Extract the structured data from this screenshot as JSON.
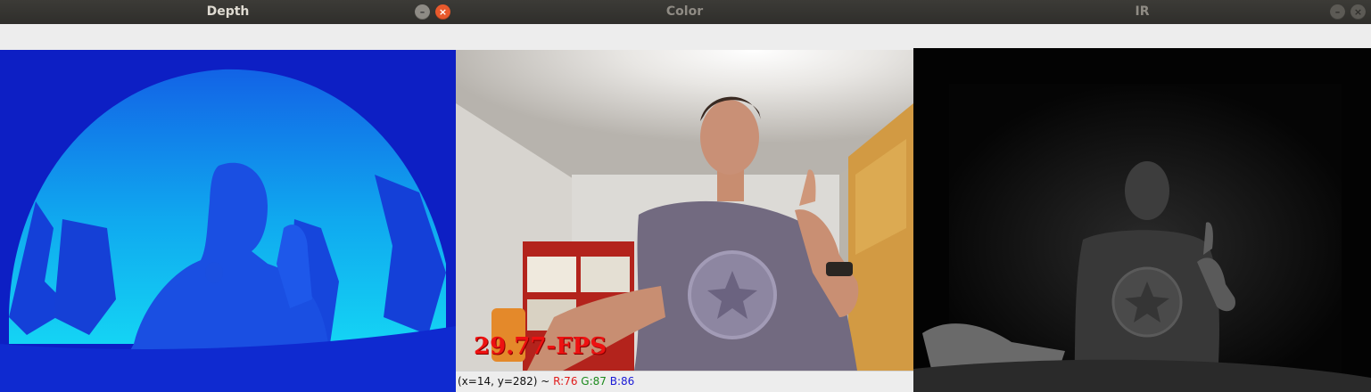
{
  "windows": {
    "depth": {
      "title": "Depth",
      "minimize": "–",
      "close": "×"
    },
    "color": {
      "title": "Color",
      "minimize": "–",
      "close": "×"
    },
    "ir": {
      "title": "IR",
      "minimize": "–",
      "close": "×"
    }
  },
  "color_view": {
    "fps_overlay": "29.77-FPS",
    "status": {
      "coords": "(x=14, y=282) ~ ",
      "r": "R:76",
      "g": "G:87",
      "b": "B:86"
    }
  },
  "colors": {
    "depth_far": "#0d1fc4",
    "depth_near": "#12c6f0",
    "titlebar": "#3c3b37",
    "close_button": "#e8592c",
    "fps_text": "#ee1111"
  }
}
